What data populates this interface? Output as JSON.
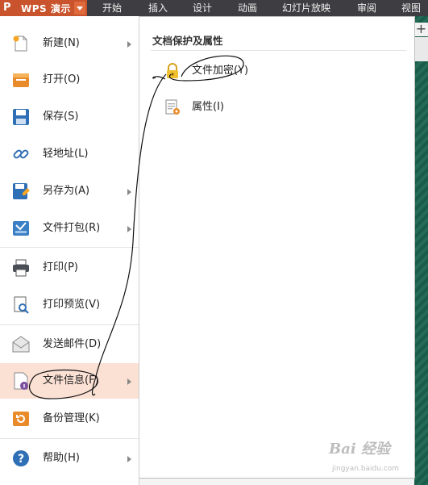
{
  "app": {
    "logo_letter": "P",
    "name": "WPS 演示"
  },
  "ribbon_tabs": [
    "开始",
    "插入",
    "设计",
    "动画",
    "幻灯片放映",
    "审阅",
    "视图"
  ],
  "menu": {
    "items": [
      {
        "label": "新建(N)",
        "icon": "new-document-icon",
        "arrow": true
      },
      {
        "label": "打开(O)",
        "icon": "open-folder-icon",
        "arrow": false
      },
      {
        "label": "保存(S)",
        "icon": "save-disk-icon",
        "arrow": false
      },
      {
        "label": "轻地址(L)",
        "icon": "link-icon",
        "arrow": false
      },
      {
        "label": "另存为(A)",
        "icon": "save-as-icon",
        "arrow": true
      },
      {
        "label": "文件打包(R)",
        "icon": "package-icon",
        "arrow": true
      },
      {
        "label": "打印(P)",
        "icon": "printer-icon",
        "arrow": false
      },
      {
        "label": "打印预览(V)",
        "icon": "print-preview-icon",
        "arrow": false
      },
      {
        "label": "发送邮件(D)",
        "icon": "mail-icon",
        "arrow": false
      },
      {
        "label": "文件信息(F)",
        "icon": "file-info-icon",
        "arrow": true,
        "selected": true
      },
      {
        "label": "备份管理(K)",
        "icon": "backup-icon",
        "arrow": false
      },
      {
        "label": "帮助(H)",
        "icon": "help-icon",
        "arrow": true
      }
    ]
  },
  "submenu": {
    "title": "文档保护及属性",
    "items": [
      {
        "label": "文件加密(Y)",
        "icon": "lock-icon"
      },
      {
        "label": "属性(I)",
        "icon": "properties-icon"
      }
    ]
  },
  "watermark": {
    "logo": "Bai 经验",
    "url": "jingyan.baidu.com"
  },
  "colors": {
    "accent": "#c9532c",
    "ribbon": "#3e3e42",
    "selected_bg": "#fbe0d4"
  }
}
